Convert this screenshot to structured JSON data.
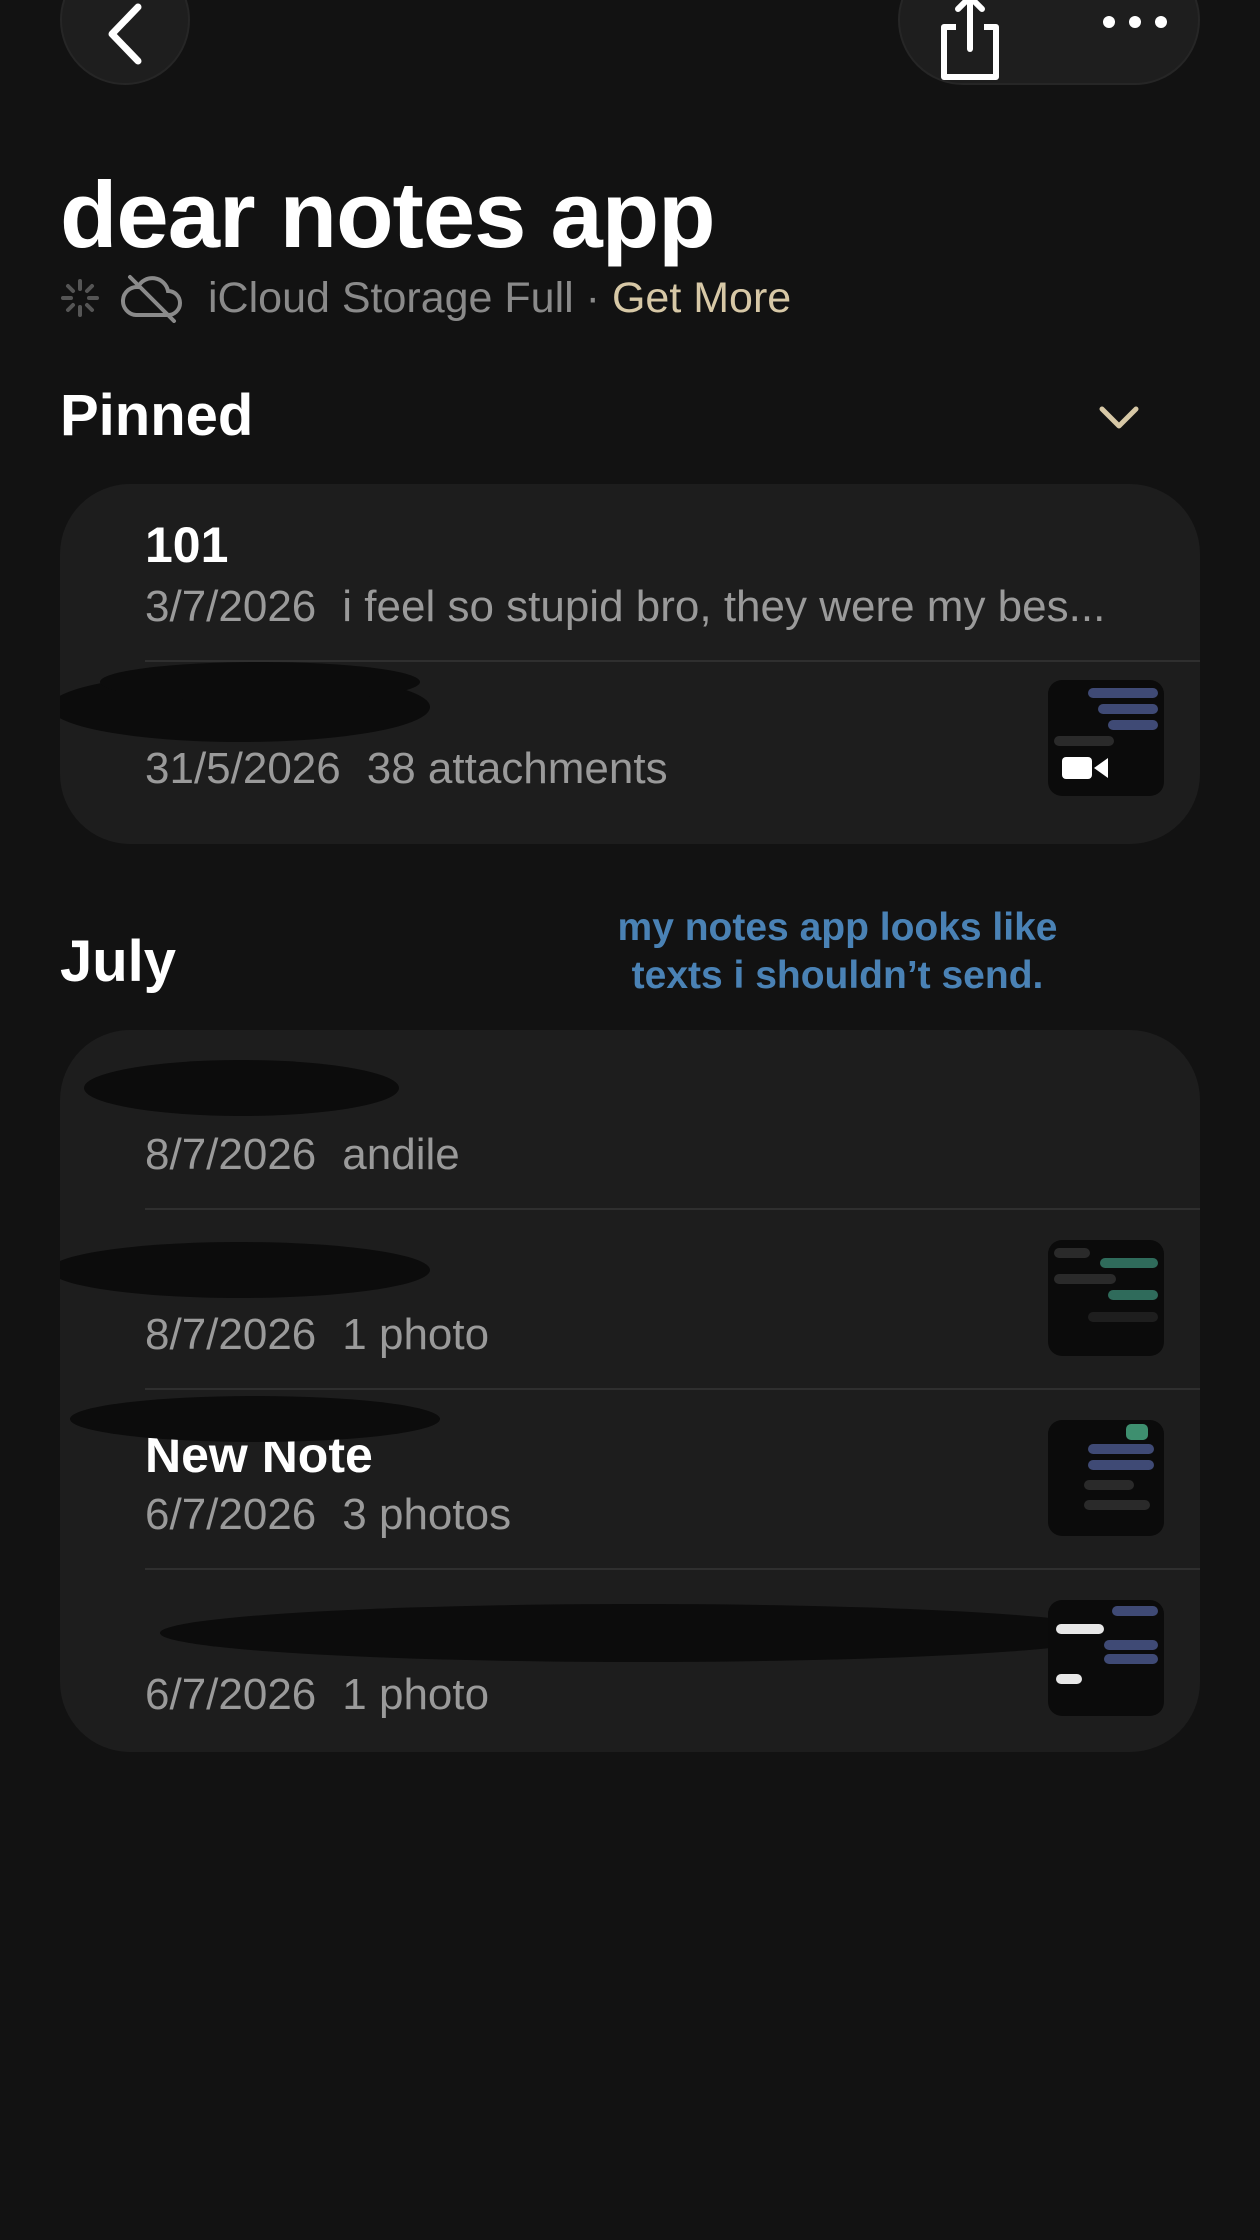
{
  "nav": {
    "back_icon": "chevron-left-icon",
    "share_icon": "share-icon",
    "more_icon": "ellipsis-icon"
  },
  "folder": {
    "title": "dear notes app"
  },
  "storage": {
    "status_text": "iCloud Storage Full ·",
    "link_text": "Get More",
    "link_color": "#d7c8a6"
  },
  "pinned": {
    "header": "Pinned",
    "notes": [
      {
        "title": "101",
        "date": "3/7/2026",
        "preview": "i feel so stupid bro, they were my bes..."
      },
      {
        "title": "",
        "date": "31/5/2026",
        "preview": "38 attachments",
        "thumbnail": "video-thumbnail"
      }
    ]
  },
  "july": {
    "header": "July",
    "notes": [
      {
        "title": "",
        "date": "8/7/2026",
        "preview": "andile"
      },
      {
        "title": "",
        "date": "8/7/2026",
        "preview": "1 photo",
        "thumbnail": "chat-screenshot"
      },
      {
        "title": "New Note",
        "date": "6/7/2026",
        "preview": "3 photos",
        "thumbnail": "chat-screenshot"
      },
      {
        "title": "",
        "date": "6/7/2026",
        "preview": "1 photo",
        "thumbnail": "chat-screenshot"
      }
    ]
  },
  "annotation": {
    "line1": "my notes app looks like",
    "line2": "texts i shouldn’t send.",
    "color": "#4a82b5"
  }
}
